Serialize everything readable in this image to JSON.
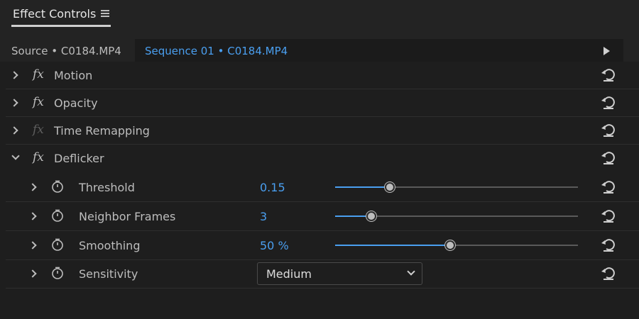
{
  "panel": {
    "title": "Effect Controls"
  },
  "tabs": {
    "source": "Source • C0184.MP4",
    "sequence": "Sequence 01 • C0184.MP4"
  },
  "effects": [
    {
      "label": "Motion",
      "fx": "fx",
      "enabled": true,
      "expanded": false
    },
    {
      "label": "Opacity",
      "fx": "fx",
      "enabled": true,
      "expanded": false
    },
    {
      "label": "Time Remapping",
      "fx": "fx",
      "enabled": false,
      "expanded": false
    },
    {
      "label": "Deflicker",
      "fx": "fx",
      "enabled": true,
      "expanded": true
    }
  ],
  "params": [
    {
      "label": "Threshold",
      "value": "0.15",
      "slider_fraction": 0.226
    },
    {
      "label": "Neighbor Frames",
      "value": "3",
      "slider_fraction": 0.148
    },
    {
      "label": "Smoothing",
      "value": "50 %",
      "slider_fraction": 0.475
    },
    {
      "label": "Sensitivity",
      "dropdown_value": "Medium"
    }
  ],
  "colors": {
    "accent": "#4a9ff0",
    "background": "#1e1e1e",
    "text": "#bdbdbd"
  }
}
